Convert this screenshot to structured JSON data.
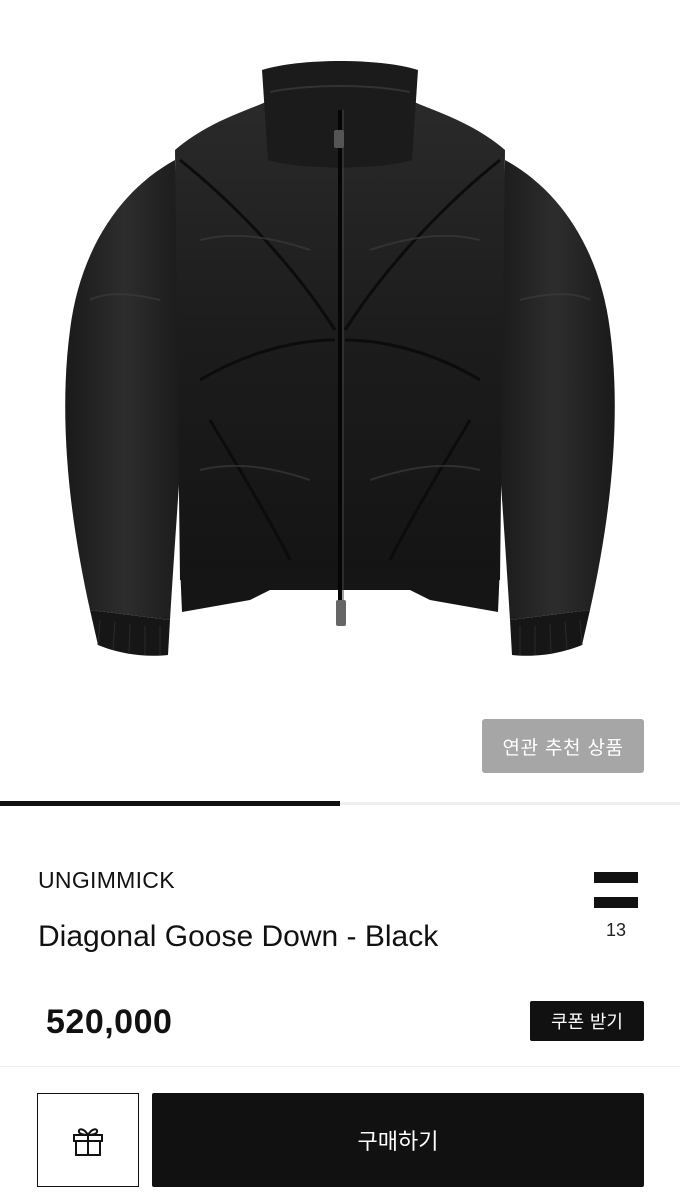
{
  "gallery": {
    "image_alt": "Black quilted goose down bomber jacket",
    "progress": 0.5
  },
  "related_button": {
    "label": "연관 추천 상품"
  },
  "product": {
    "brand": "UNGIMMICK",
    "name": "Diagonal Goose Down - Black",
    "price": "520,000"
  },
  "count": {
    "value": "13",
    "icon": "equals-icon"
  },
  "coupon_button": {
    "label": "쿠폰 받기"
  },
  "bottom_bar": {
    "gift_icon": "gift-icon",
    "buy_label": "구매하기"
  },
  "colors": {
    "primary": "#111111",
    "muted_button": "#a6a6a6",
    "background": "#ffffff"
  }
}
